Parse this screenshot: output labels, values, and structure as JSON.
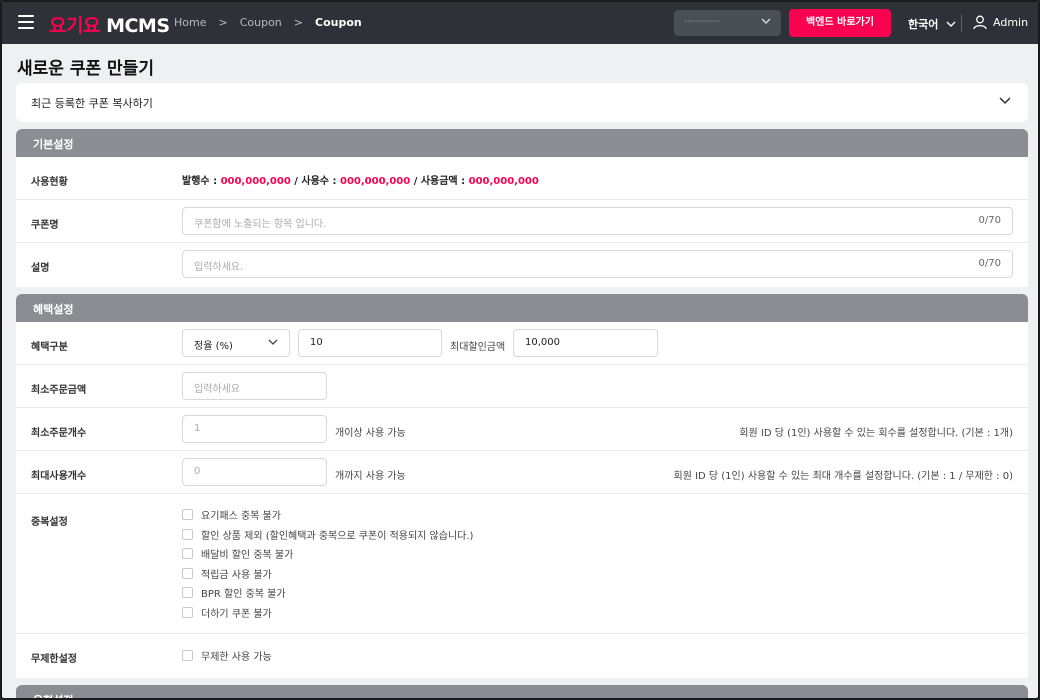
{
  "header": {
    "logo_brand": "요기요",
    "logo_product": "MCMS",
    "breadcrumb": [
      "Home",
      "Coupon",
      "Coupon"
    ],
    "select_placeholder": "----------",
    "backend_button": "백엔드 바로가기",
    "language": "한국어",
    "user": "Admin",
    "accent_color": "#fa0050"
  },
  "page": {
    "title": "새로운 쿠폰 만들기",
    "copy_recent": "최근 등록한 쿠폰 복사하기"
  },
  "basic": {
    "title": "기본설정",
    "usage_label": "사용현황",
    "usage_issued_label": "발행수 : ",
    "usage_issued_value": "000,000,000",
    "usage_used_label": " / 사용수 : ",
    "usage_used_value": "000,000,000",
    "usage_amount_label": " / 사용금액 : ",
    "usage_amount_value": "000,000,000",
    "name_label": "쿠폰명",
    "name_placeholder": "쿠폰함에 노출되는 항목 입니다.",
    "name_count": "0/70",
    "desc_label": "설명",
    "desc_placeholder": "입력하세요.",
    "desc_count": "0/70"
  },
  "benefit": {
    "title": "혜택설정",
    "type_label": "혜택구분",
    "type_select": "정율 (%)",
    "type_value": "10",
    "max_discount_label": "최대할인금액",
    "max_discount_value": "10,000",
    "min_order_amount_label": "최소주문금액",
    "min_order_amount_placeholder": "입력하세요",
    "min_order_count_label": "최소주문개수",
    "min_order_count_placeholder": "1",
    "min_order_count_suffix": "개이상 사용 가능",
    "min_order_count_note": "회원 ID 당 (1인) 사용할 수 있는 회수를 설정합니다. (기본 : 1개)",
    "max_use_label": "최대사용개수",
    "max_use_placeholder": "0",
    "max_use_suffix": "개까지 사용 가능",
    "max_use_note": "회원 ID 당 (1인) 사용할 수 있는 최대 개수를 설정합니다. (기본 : 1 / 무제한 : 0)",
    "dup_label": "중복설정",
    "dup_options": [
      "요기패스 중복 불가",
      "할인 상품 제외 (할인혜택과 중복으로 쿠폰이 적용되지 않습니다.)",
      "배달비 할인 중복 불가",
      "적립금 사용 불가",
      "BPR 할인 중복 불가",
      "더하기 쿠폰 불가"
    ],
    "unlimited_label": "무제한설정",
    "unlimited_option": "무제한 사용 가능"
  },
  "next_section_title": "유형설정"
}
